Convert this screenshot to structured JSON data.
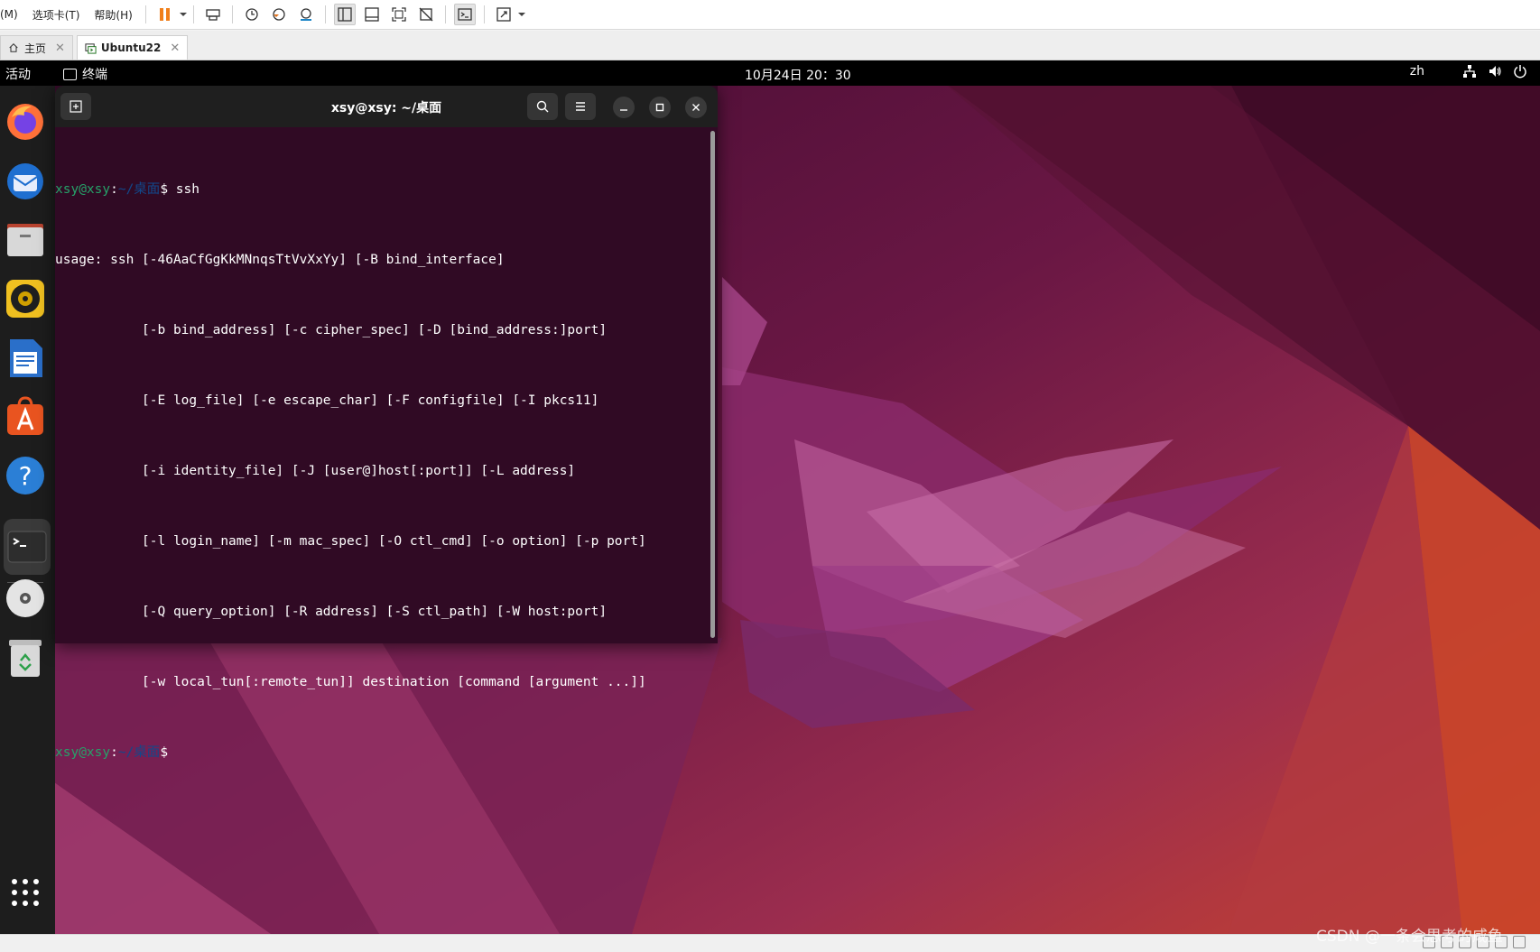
{
  "vmware": {
    "menus": [
      "(M)",
      "选项卡(T)",
      "帮助(H)"
    ],
    "tabs": [
      {
        "label": "主页",
        "active": false
      },
      {
        "label": "Ubuntu22",
        "active": true
      }
    ]
  },
  "ubuntu": {
    "topbar": {
      "activities": "活动",
      "app_name": "终端",
      "clock": "10月24日  20：30",
      "input_method": "zh"
    },
    "dock": [
      "firefox-icon",
      "thunderbird-icon",
      "files-icon",
      "rhythmbox-icon",
      "writer-icon",
      "app-center-icon",
      "help-icon",
      "terminal-icon",
      "dvd-icon",
      "trash-icon",
      "show-apps-icon"
    ]
  },
  "terminal": {
    "title": "xsy@xsy: ~/桌面",
    "prompt_user": "xsy@xsy",
    "prompt_sep": ":",
    "prompt_path": "~/桌面",
    "prompt_symbol": "$",
    "command": " ssh",
    "output": [
      "usage: ssh [-46AaCfGgKkMNnqsTtVvXxYy] [-B bind_interface]",
      "           [-b bind_address] [-c cipher_spec] [-D [bind_address:]port]",
      "           [-E log_file] [-e escape_char] [-F configfile] [-I pkcs11]",
      "           [-i identity_file] [-J [user@]host[:port]] [-L address]",
      "           [-l login_name] [-m mac_spec] [-O ctl_cmd] [-o option] [-p port]",
      "           [-Q query_option] [-R address] [-S ctl_path] [-W host:port]",
      "           [-w local_tun[:remote_tun]] destination [command [argument ...]]"
    ]
  },
  "watermark": "CSDN @一条会思考的咸鱼",
  "colors": {
    "terminal_bg": "#300a24",
    "prompt_user": "#26a269",
    "prompt_path": "#12488b",
    "topbar": "#000000",
    "dock": "#1d1d1d"
  }
}
